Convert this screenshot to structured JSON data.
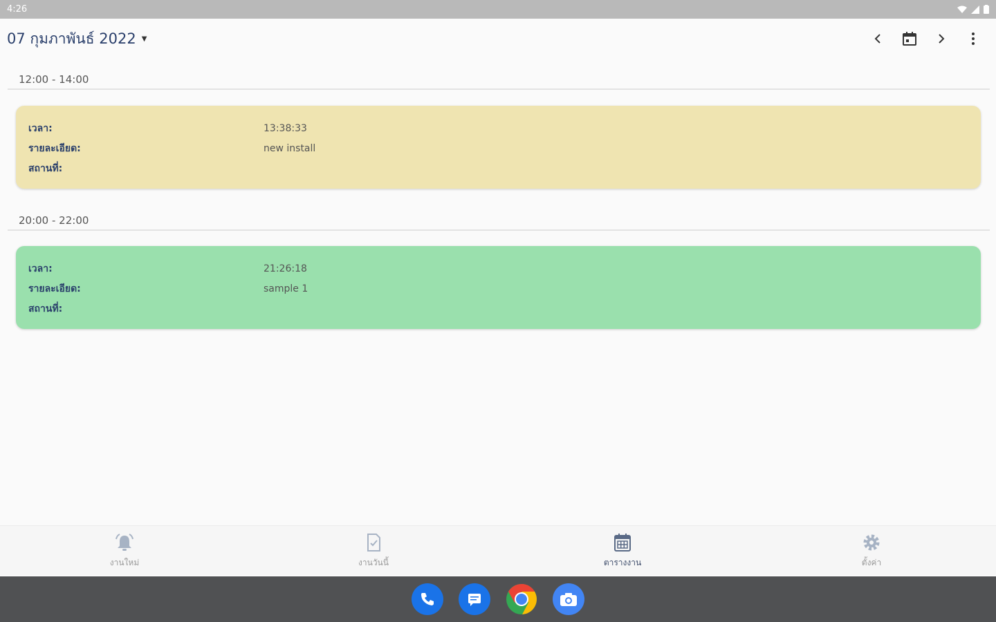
{
  "status_bar": {
    "time": "4:26"
  },
  "app_bar": {
    "date_title": "07 กุมภาพันธ์ 2022"
  },
  "groups": [
    {
      "range": "12:00 - 14:00",
      "card": {
        "color": "#efe4b1",
        "time_label": "เวลา:",
        "time_value": "13:38:33",
        "detail_label": "รายละเอียด:",
        "detail_value": "new install",
        "place_label": "สถานที่:",
        "place_value": ""
      }
    },
    {
      "range": "20:00 - 22:00",
      "card": {
        "color": "#9ae0ad",
        "time_label": "เวลา:",
        "time_value": "21:26:18",
        "detail_label": "รายละเอียด:",
        "detail_value": "sample 1",
        "place_label": "สถานที่:",
        "place_value": ""
      }
    }
  ],
  "bottom_nav": [
    {
      "label": "งานใหม่",
      "icon": "alarm-icon",
      "active": false
    },
    {
      "label": "งานวันนี้",
      "icon": "task-doc-icon",
      "active": false
    },
    {
      "label": "ตารางงาน",
      "icon": "calendar-icon",
      "active": true
    },
    {
      "label": "ตั้งค่า",
      "icon": "gear-icon",
      "active": false
    }
  ],
  "dock": [
    {
      "icon": "phone-icon"
    },
    {
      "icon": "messages-icon"
    },
    {
      "icon": "chrome-icon"
    },
    {
      "icon": "camera-icon"
    }
  ]
}
